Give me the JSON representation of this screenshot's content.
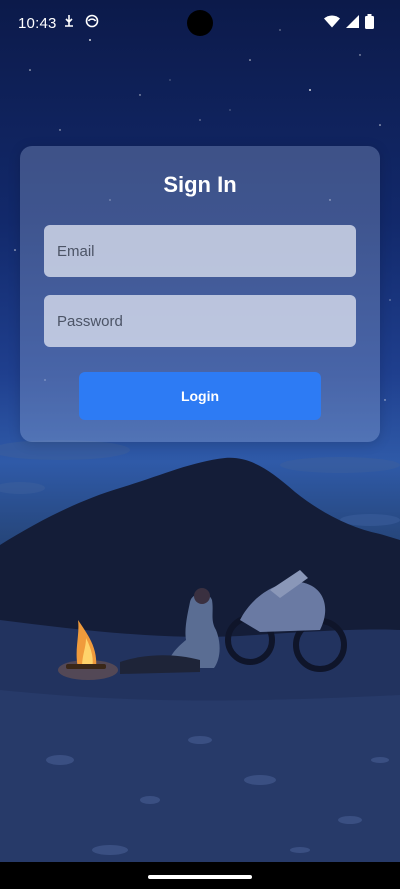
{
  "status_bar": {
    "time": "10:43",
    "left_icons": [
      "usb-debug-icon",
      "app-notification-icon"
    ],
    "right_icons": [
      "wifi-icon",
      "cell-signal-icon",
      "battery-icon"
    ]
  },
  "login_card": {
    "title": "Sign In",
    "email_placeholder": "Email",
    "email_value": "",
    "password_placeholder": "Password",
    "password_value": "",
    "login_label": "Login"
  },
  "colors": {
    "primary_button": "#2d7bf4",
    "card_background": "rgba(170,190,230,0.30)",
    "field_background": "rgba(220,226,240,0.78)"
  }
}
